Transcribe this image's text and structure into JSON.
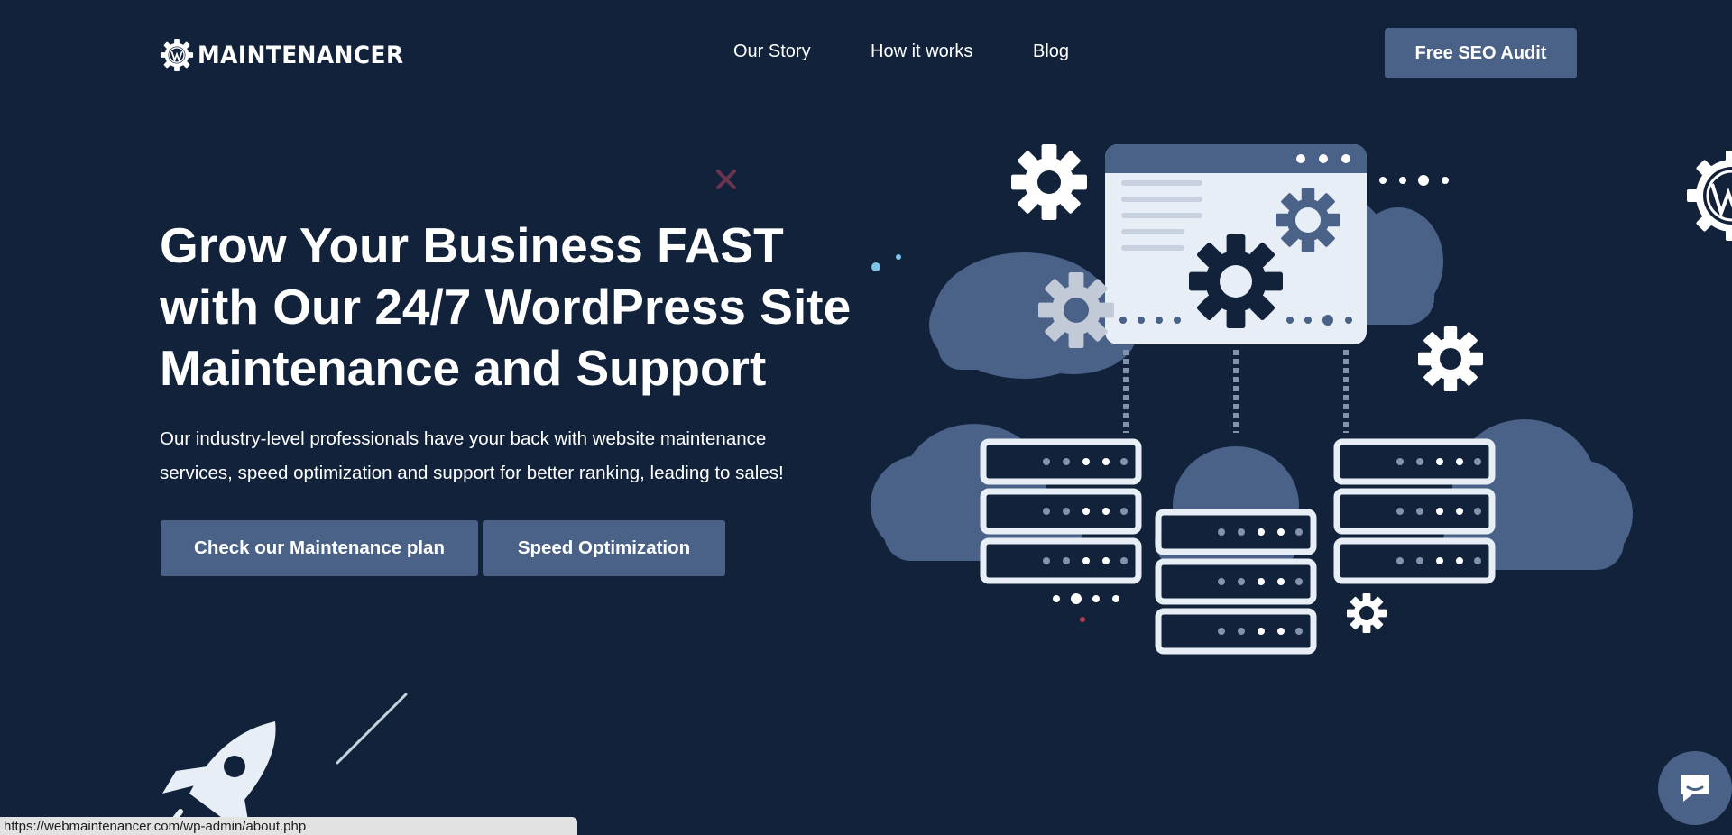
{
  "brand": {
    "name": "MAINTENANCER"
  },
  "nav": {
    "items": [
      {
        "label": "Our Story"
      },
      {
        "label": "How it works"
      },
      {
        "label": "Blog"
      }
    ],
    "cta_label": "Free SEO Audit"
  },
  "hero": {
    "title_lines": [
      "Grow Your Business FAST",
      "with Our 24/7 WordPress Site",
      "Maintenance and Support"
    ],
    "subtitle_lines": [
      "Our industry-level professionals have your back with website maintenance",
      "services, speed optimization and support for better ranking, leading to sales!"
    ],
    "primary_button": "Check our Maintenance plan",
    "secondary_button": "Speed Optimization"
  },
  "status_bar": {
    "url": "https://webmaintenancer.com/wp-admin/about.php"
  },
  "icons": {
    "logo": "wordpress-gear-icon",
    "chat": "chat-bubble-icon",
    "rocket": "rocket-icon"
  },
  "colors": {
    "background": "#12223b",
    "button": "#4a6288",
    "cloud": "#4a6288",
    "server": "#ffffff",
    "accent_pink": "#b0405a"
  }
}
